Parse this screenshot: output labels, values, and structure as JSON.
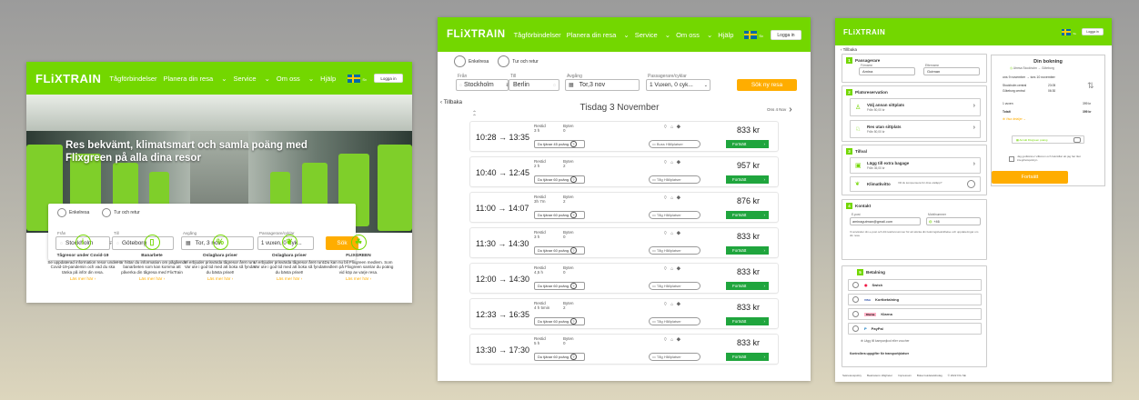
{
  "brand": {
    "logo": "FLiXTRAIN",
    "green": "#73d700",
    "orange": "#ffad00",
    "dark_green": "#1fa53d"
  },
  "nav": {
    "items": [
      "Tågförbindelser",
      "Planera din resa",
      "Service",
      "Om oss",
      "Hjälp"
    ],
    "login": "Logga in",
    "lang": "Sv"
  },
  "home": {
    "headline": "Res bekvämt, klimatsmart och samla poäng med Flixgreen på alla dina resor",
    "trip_one_way": "Enkelresa",
    "trip_return": "Tur och retur",
    "from_label": "Från",
    "from_value": "Stockholm",
    "to_label": "Till",
    "to_value": "Göteborg",
    "date_label": "Avgång",
    "date_value": "Tor, 3 nov",
    "pass_label": "Passagerare/cyklar",
    "pass_value": "1 vuxen, 0 Cyk...",
    "search_btn": "Sök",
    "features": [
      {
        "icon": "info-icon",
        "glyph": "i",
        "title": "Tågresor under Covid-19",
        "text": "Se uppdaterad information resor under Covid-19-pandemin och vad du ska tänka på inför din resa.",
        "link": "Läs mer här"
      },
      {
        "icon": "train-icon",
        "glyph": "▯",
        "title": "Banarbete",
        "text": "Här hittar du information om pågående banarbeten som kan komma att påverka din tågresa med FlixTrain",
        "link": "Läs mer här"
      },
      {
        "icon": "percent-icon",
        "glyph": "%",
        "title": "Oslagbara priser",
        "text": "Vi erbjuder prisvärda tågresor året runt. Var ute i god tid med att boka så fyndar du bästa priset!",
        "link": "Läs mer här"
      },
      {
        "icon": "leaf-icon",
        "glyph": "❦",
        "title": "Oslagbara priser",
        "text": "Vi erbjuder prisvärda tågresor året runt. Var ute i god tid med att boka så fyndar du bästa priset!",
        "link": "Läs mer här"
      },
      {
        "icon": "hand-icon",
        "glyph": "☘",
        "title": "FLIXGREEN",
        "text": "Du kan nu bli Flixgreen medlem. Som medlem på Flixgreen samlar du poäng vid köp av varje resa.",
        "link": "Läs mer här"
      }
    ]
  },
  "results": {
    "trip_one_way": "Enkelresa",
    "trip_return": "Tur och retur",
    "from_label": "Från",
    "from_value": "Stockholm",
    "to_label": "Till",
    "to_value": "Berlin",
    "date_label": "Avgång",
    "date_value": "Tor,3 nov",
    "pass_label": "Passagerare/cyklar",
    "pass_value": "1 Vuxen, 0 cyk...",
    "search_btn": "Sök ny resa",
    "back": "Tillbaka",
    "day_title": "Tisdag 3 November",
    "next_day": "Ons 4 Nov",
    "dur_label": "Restid",
    "chg_label": "Byten",
    "continue": "Fortsätt",
    "amenities": "⌔ ⌂ ◆",
    "rows": [
      {
        "time": "10:28 → 13:35",
        "dur": "3 h",
        "chg": "0",
        "points": "Du tjänar 45 poäng.",
        "sel": "Buss   Hållplatser",
        "price": "833 kr"
      },
      {
        "time": "10:40 → 12:45",
        "dur": "2 h",
        "chg": "2",
        "points": "Du tjänar 60 poäng.",
        "sel": "Tåg   Hållplatser",
        "price": "957 kr"
      },
      {
        "time": "11:00 → 14:07",
        "dur": "3h 7m",
        "chg": "2",
        "points": "Du tjänar 60 poäng.",
        "sel": "Tåg   Hållplatser",
        "price": "876 kr"
      },
      {
        "time": "11:30 → 14:30",
        "dur": "3 h",
        "chg": "0",
        "points": "Du tjänar 60 poäng.",
        "sel": "Tåg   Hållplatser",
        "price": "833 kr"
      },
      {
        "time": "12:00 → 14:30",
        "dur": "4,5 h",
        "chg": "0",
        "points": "Du tjänar 60 poäng.",
        "sel": "Tåg   Hållplatser",
        "price": "833 kr"
      },
      {
        "time": "12:33 → 16:35",
        "dur": "4 h 5min",
        "chg": "2",
        "points": "Du tjänar 60 poäng.",
        "sel": "Tåg   Hållplatser",
        "price": "833 kr"
      },
      {
        "time": "13:30 → 17:30",
        "dur": "5 h",
        "chg": "0",
        "points": "Du tjänar 60 poäng.",
        "sel": "Tåg   Hållplatser",
        "price": "833 kr"
      }
    ]
  },
  "checkout": {
    "back": "Tillbaka",
    "s1_title": "Passagerare",
    "first_label": "Förnamn",
    "first_value": "Amina",
    "last_label": "Efternamn",
    "last_value": "Gutman",
    "s2_title": "Platsreservation",
    "seat_opt1": "Välj annan sittplats",
    "seat_opt1_sub": "Från 50,00 kr",
    "seat_opt2": "Res utan sittplats",
    "seat_opt2_sub": "Från 50,00 kr",
    "s3_title": "Tillval",
    "extra_bag": "Lägg till extra bagage",
    "extra_bag_sub": "Från 35,00 kr",
    "climate": "Klimatkvitto",
    "climate_note": "Vill du kompensera för dina utsläpp?",
    "s4_title": "Kontakt",
    "email_label": "E-post",
    "email_value": "aminagutman@gmail.com",
    "phone_label": "Mobilnummer",
    "phone_value": "+46",
    "contact_note": "Vi använder din e-post och ditt telefonnummer för att skicka din bokningsbekräftelse och uppdateringar om din resa.",
    "s5_title": "Betalning",
    "payments": [
      "Swish",
      "Kortbetalning",
      "Klarna",
      "PayPal"
    ],
    "voucher": "Lägg till kampanjkod eller voucher",
    "terms": "Kontrollera uppgifter för transport/platser",
    "footer": [
      "Sekretesspolicy",
      "Beatratens villigheter",
      "Impressum",
      "Boka Guidetatsbolag",
      "© 2022 Flix SE"
    ],
    "booking_title": "Din bokning",
    "book_outbound": "Utresa Stockholm → Göteborg",
    "book_date_from": "ons 9 november",
    "book_date_to": "tors 10 november",
    "stop1": "Stockholm central",
    "stop1_time": "23:05",
    "stop2": "Göteborg central",
    "stop2_time": "06:30",
    "adult_label": "1 vuxen",
    "adult_price": "399 kr",
    "total_label": "Totalt",
    "total_price": "399 kr",
    "show_more": "Visa detaljer",
    "flixgreen_label": "Anmäl Flixgreen poäng",
    "terms_check": "Jag godkänner villkoren och bekräftar att jag har läst integritetspolicyn.",
    "continue": "Fortsätt"
  }
}
